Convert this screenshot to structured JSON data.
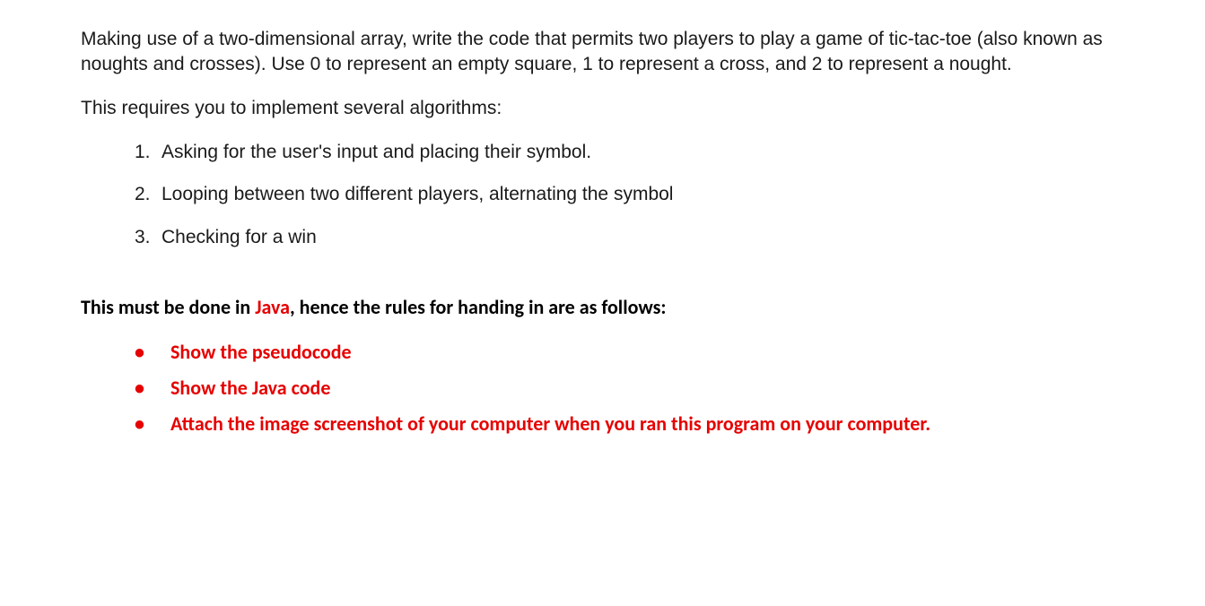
{
  "intro": {
    "p1": "Making use of a two-dimensional array, write the code that permits two players to play a game of tic-tac-toe (also known as noughts and crosses).  Use 0 to represent an empty square, 1 to represent a cross, and 2 to represent a nought.",
    "p2": "This requires you to implement several algorithms:"
  },
  "algorithms": [
    "Asking for the user's input and placing their symbol.",
    "Looping between two different players, alternating the symbol",
    "Checking for a win"
  ],
  "instruction": {
    "prefix": "This must be done in ",
    "highlight": "Java",
    "suffix": ", hence the rules for handing in are as follows:"
  },
  "requirements": [
    "Show the pseudocode",
    "Show the Java code",
    "Attach the image screenshot of your computer when you ran this program on your computer."
  ]
}
